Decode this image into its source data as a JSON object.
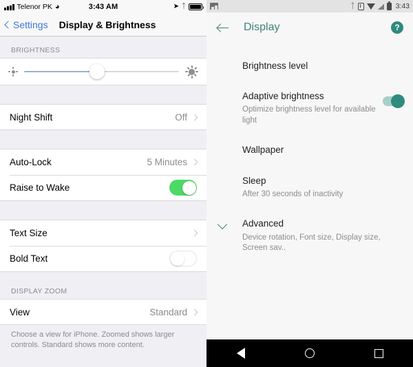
{
  "ios": {
    "status_bar": {
      "carrier": "Telenor PK",
      "time": "3:43 AM",
      "icons": [
        "signal-bars-icon",
        "wifi-icon",
        "location-arrow-icon",
        "bluetooth-icon",
        "battery-icon"
      ]
    },
    "nav": {
      "back_label": "Settings",
      "title": "Display & Brightness"
    },
    "sections": [
      {
        "header": "BRIGHTNESS",
        "slider": {
          "name": "brightness-slider",
          "value_percent": 47,
          "min_icon": "small-sun-icon",
          "max_icon": "large-sun-icon"
        }
      }
    ],
    "rows": {
      "night_shift": {
        "label": "Night Shift",
        "value": "Off"
      },
      "auto_lock": {
        "label": "Auto-Lock",
        "value": "5 Minutes"
      },
      "raise_to_wake": {
        "label": "Raise to Wake",
        "toggle": "on"
      },
      "text_size": {
        "label": "Text Size"
      },
      "bold_text": {
        "label": "Bold Text",
        "toggle": "off"
      },
      "view": {
        "label": "View",
        "value": "Standard"
      }
    },
    "display_zoom_header": "DISPLAY ZOOM",
    "footnote": "Choose a view for iPhone. Zoomed shows larger controls. Standard shows more content.",
    "colors": {
      "accent": "#3C78D8",
      "toggle_on": "#4CD964",
      "group_bg": "#EFEFF4"
    }
  },
  "android": {
    "status_bar": {
      "time": "3:43",
      "icons": [
        "photo-icon",
        "bluetooth-icon",
        "vibrate-icon",
        "wifi-icon",
        "signal-icon",
        "battery-icon"
      ]
    },
    "app_bar": {
      "title": "Display",
      "back_icon": "arrow-back-icon",
      "help_icon": "help-circle-icon",
      "help_label": "?"
    },
    "items": [
      {
        "title": "Brightness level",
        "subtitle": ""
      },
      {
        "title": "Adaptive brightness",
        "subtitle": "Optimize brightness level for available light",
        "toggle": "on"
      },
      {
        "title": "Wallpaper",
        "subtitle": ""
      },
      {
        "title": "Sleep",
        "subtitle": "After 30 seconds of inactivity"
      },
      {
        "title": "Advanced",
        "subtitle": "Device rotation, Font size, Display size, Screen sav..",
        "icon": "chevron-down-icon"
      }
    ],
    "nav_bar": {
      "back": "back-triangle-icon",
      "home": "home-circle-icon",
      "recents": "recents-square-icon"
    },
    "colors": {
      "accent": "#3E8277",
      "toggle_on": "#2E8B7E",
      "bg": "#F7F7F7"
    }
  }
}
